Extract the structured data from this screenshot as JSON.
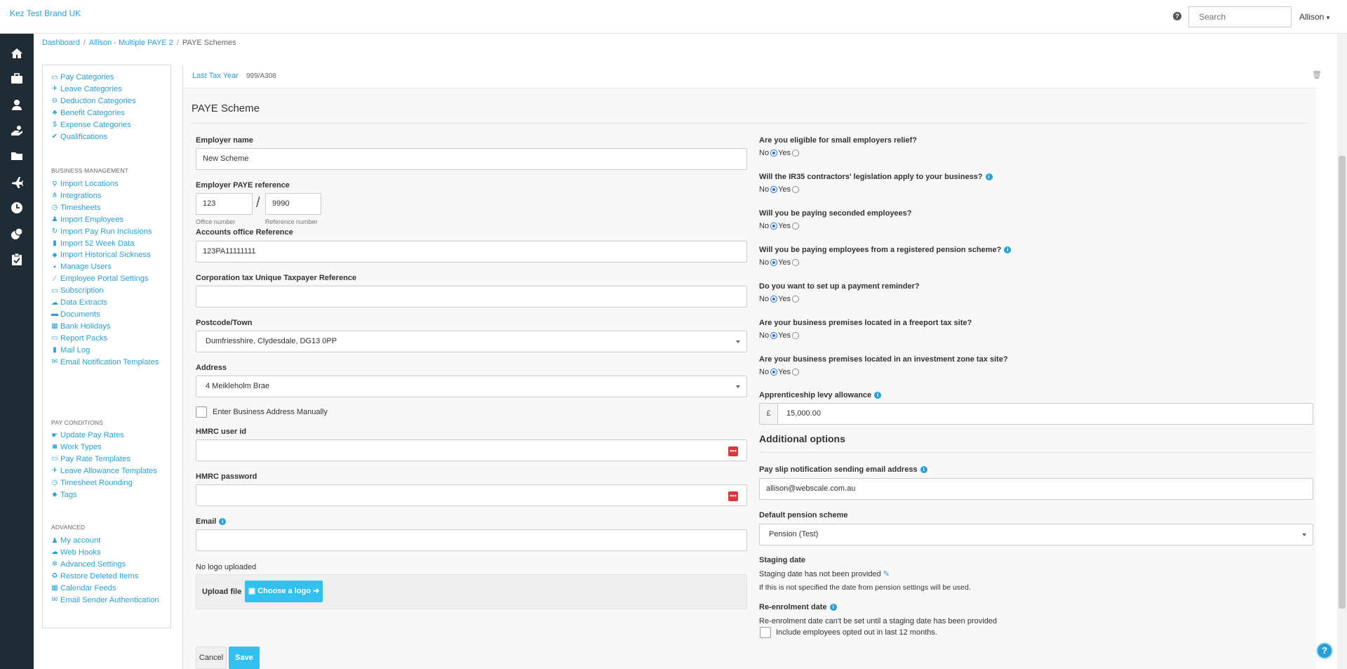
{
  "topbar": {
    "brand": "Kez Test Brand UK",
    "help_glyph": "?",
    "search_placeholder": "Search",
    "user": "Allison",
    "user_caret": "▾"
  },
  "nav_icons": [
    "home-icon",
    "briefcase-icon",
    "employees-icon",
    "payment-icon",
    "folder-icon",
    "plane-icon",
    "clock-icon",
    "coins-icon",
    "clipboard-icon"
  ],
  "breadcrumb": {
    "items": [
      "Dashboard",
      "Allison - Multiple PAYE 2"
    ],
    "sep": "/",
    "current": "PAYE Schemes"
  },
  "sidebar": {
    "items_top": [
      {
        "label": "Pay Categories",
        "icon": "money-icon"
      },
      {
        "label": "Leave Categories",
        "icon": "plane-icon"
      },
      {
        "label": "Deduction Categories",
        "icon": "minus-circle-icon"
      },
      {
        "label": "Benefit Categories",
        "icon": "benefit-icon"
      },
      {
        "label": "Expense Categories",
        "icon": "dollar-icon"
      },
      {
        "label": "Qualifications",
        "icon": "check-icon"
      }
    ],
    "business_heading": "BUSINESS MANAGEMENT",
    "business_items": [
      {
        "label": "Import Locations",
        "icon": "location-icon"
      },
      {
        "label": "Integrations",
        "icon": "integrations-icon"
      },
      {
        "label": "Timesheets",
        "icon": "clock-icon"
      },
      {
        "label": "Import Employees",
        "icon": "people-icon"
      },
      {
        "label": "Import Pay Run Inclusions",
        "icon": "refresh-icon"
      },
      {
        "label": "Import 52 Week Data",
        "icon": "file-icon"
      },
      {
        "label": "Import Historical Sickness",
        "icon": "tag-icon"
      },
      {
        "label": "Manage Users",
        "icon": "lock-icon"
      },
      {
        "label": "Employee Portal Settings",
        "icon": "wand-icon"
      },
      {
        "label": "Subscription",
        "icon": "card-icon"
      },
      {
        "label": "Data Extracts",
        "icon": "cloud-download-icon"
      },
      {
        "label": "Documents",
        "icon": "folder-icon"
      },
      {
        "label": "Bank Holidays",
        "icon": "calendar-icon"
      },
      {
        "label": "Report Packs",
        "icon": "folder-open-icon"
      },
      {
        "label": "Mail Log",
        "icon": "file-icon"
      },
      {
        "label": "Email Notification Templates",
        "icon": "envelope-icon"
      }
    ],
    "pay_heading": "PAY CONDITIONS",
    "pay_items": [
      {
        "label": "Update Pay Rates",
        "icon": "payment-icon"
      },
      {
        "label": "Work Types",
        "icon": "camera-icon"
      },
      {
        "label": "Pay Rate Templates",
        "icon": "money-icon"
      },
      {
        "label": "Leave Allowance Templates",
        "icon": "plane-icon"
      },
      {
        "label": "Timesheet Rounding",
        "icon": "clock-icon"
      },
      {
        "label": "Tags",
        "icon": "tag-icon"
      }
    ],
    "advanced_heading": "ADVANCED",
    "advanced_items": [
      {
        "label": "My account",
        "icon": "users-icon"
      },
      {
        "label": "Web Hooks",
        "icon": "cloud-icon"
      },
      {
        "label": "Advanced Settings",
        "icon": "gear-icon"
      },
      {
        "label": "Restore Deleted Items",
        "icon": "recycle-icon"
      },
      {
        "label": "Calendar Feeds",
        "icon": "calendar-icon"
      },
      {
        "label": "Email Sender Authentication",
        "icon": "envelope-icon"
      }
    ]
  },
  "tabbar": {
    "tab1": "Last Tax Year",
    "tab2": "999/A308",
    "trash_glyph": "🗑"
  },
  "form": {
    "section_title": "PAYE Scheme",
    "employer_name_label": "Employer name",
    "employer_name": "New Scheme",
    "paye_ref_label": "Employer PAYE reference",
    "office_number": "123",
    "reference_number": "9990",
    "slash": "/",
    "office_number_hint": "Office number",
    "reference_number_hint": "Reference number",
    "accounts_office_label": "Accounts office Reference",
    "accounts_office": "123PA11111111",
    "corp_tax_label": "Corporation tax Unique Taxpayer Reference",
    "corp_tax": "",
    "postcode_label": "Postcode/Town",
    "postcode": "Dumfriesshire, Clydesdale, DG13 0PP",
    "address_label": "Address",
    "address": "4 Meikleholm Brae",
    "manual_address_label": "Enter Business Address Manually",
    "hmrc_user_label": "HMRC user id",
    "hmrc_password_label": "HMRC password",
    "dots_glyph": "•••",
    "email_label": "Email",
    "no_logo": "No logo uploaded",
    "upload_label": "Upload file",
    "choose_logo": "Choose a logo",
    "cancel": "Cancel",
    "save": "Save"
  },
  "questions": [
    {
      "text": "Are you eligible for small employers relief?",
      "info": false,
      "value": "No"
    },
    {
      "text": "Will the IR35 contractors' legislation apply to your business?",
      "info": true,
      "value": "No"
    },
    {
      "text": "Will you be paying seconded employees?",
      "info": false,
      "value": "No"
    },
    {
      "text": "Will you be paying employees from a registered pension scheme?",
      "info": true,
      "value": "No"
    },
    {
      "text": "Do you want to set up a payment reminder?",
      "info": false,
      "value": "No"
    },
    {
      "text": "Are your business premises located in a freeport tax site?",
      "info": false,
      "value": "No"
    },
    {
      "text": "Are your business premises located in an investment zone tax site?",
      "info": false,
      "value": "No"
    }
  ],
  "radio_labels": {
    "no": "No",
    "yes": "Yes"
  },
  "info_glyph": "i",
  "right": {
    "levy_label": "Apprenticeship levy allowance",
    "currency": "£",
    "levy_value": "15,000.00",
    "additional_title": "Additional options",
    "payslip_email_label": "Pay slip notification sending email address",
    "payslip_email": "allison@webscale.com.au",
    "pension_label": "Default pension scheme",
    "pension_value": "Pension (Test)",
    "staging_label": "Staging date",
    "staging_text": "Staging date has not been provided",
    "staging_note": "If this is not specified the date from pension settings will be used.",
    "reenrol_label": "Re-enrolment date",
    "reenrol_text": "Re-enrolment date can't be set until a staging date has been provided",
    "include_opted_out": "Include employees opted out in last 12 months."
  },
  "help_bubble": "?"
}
